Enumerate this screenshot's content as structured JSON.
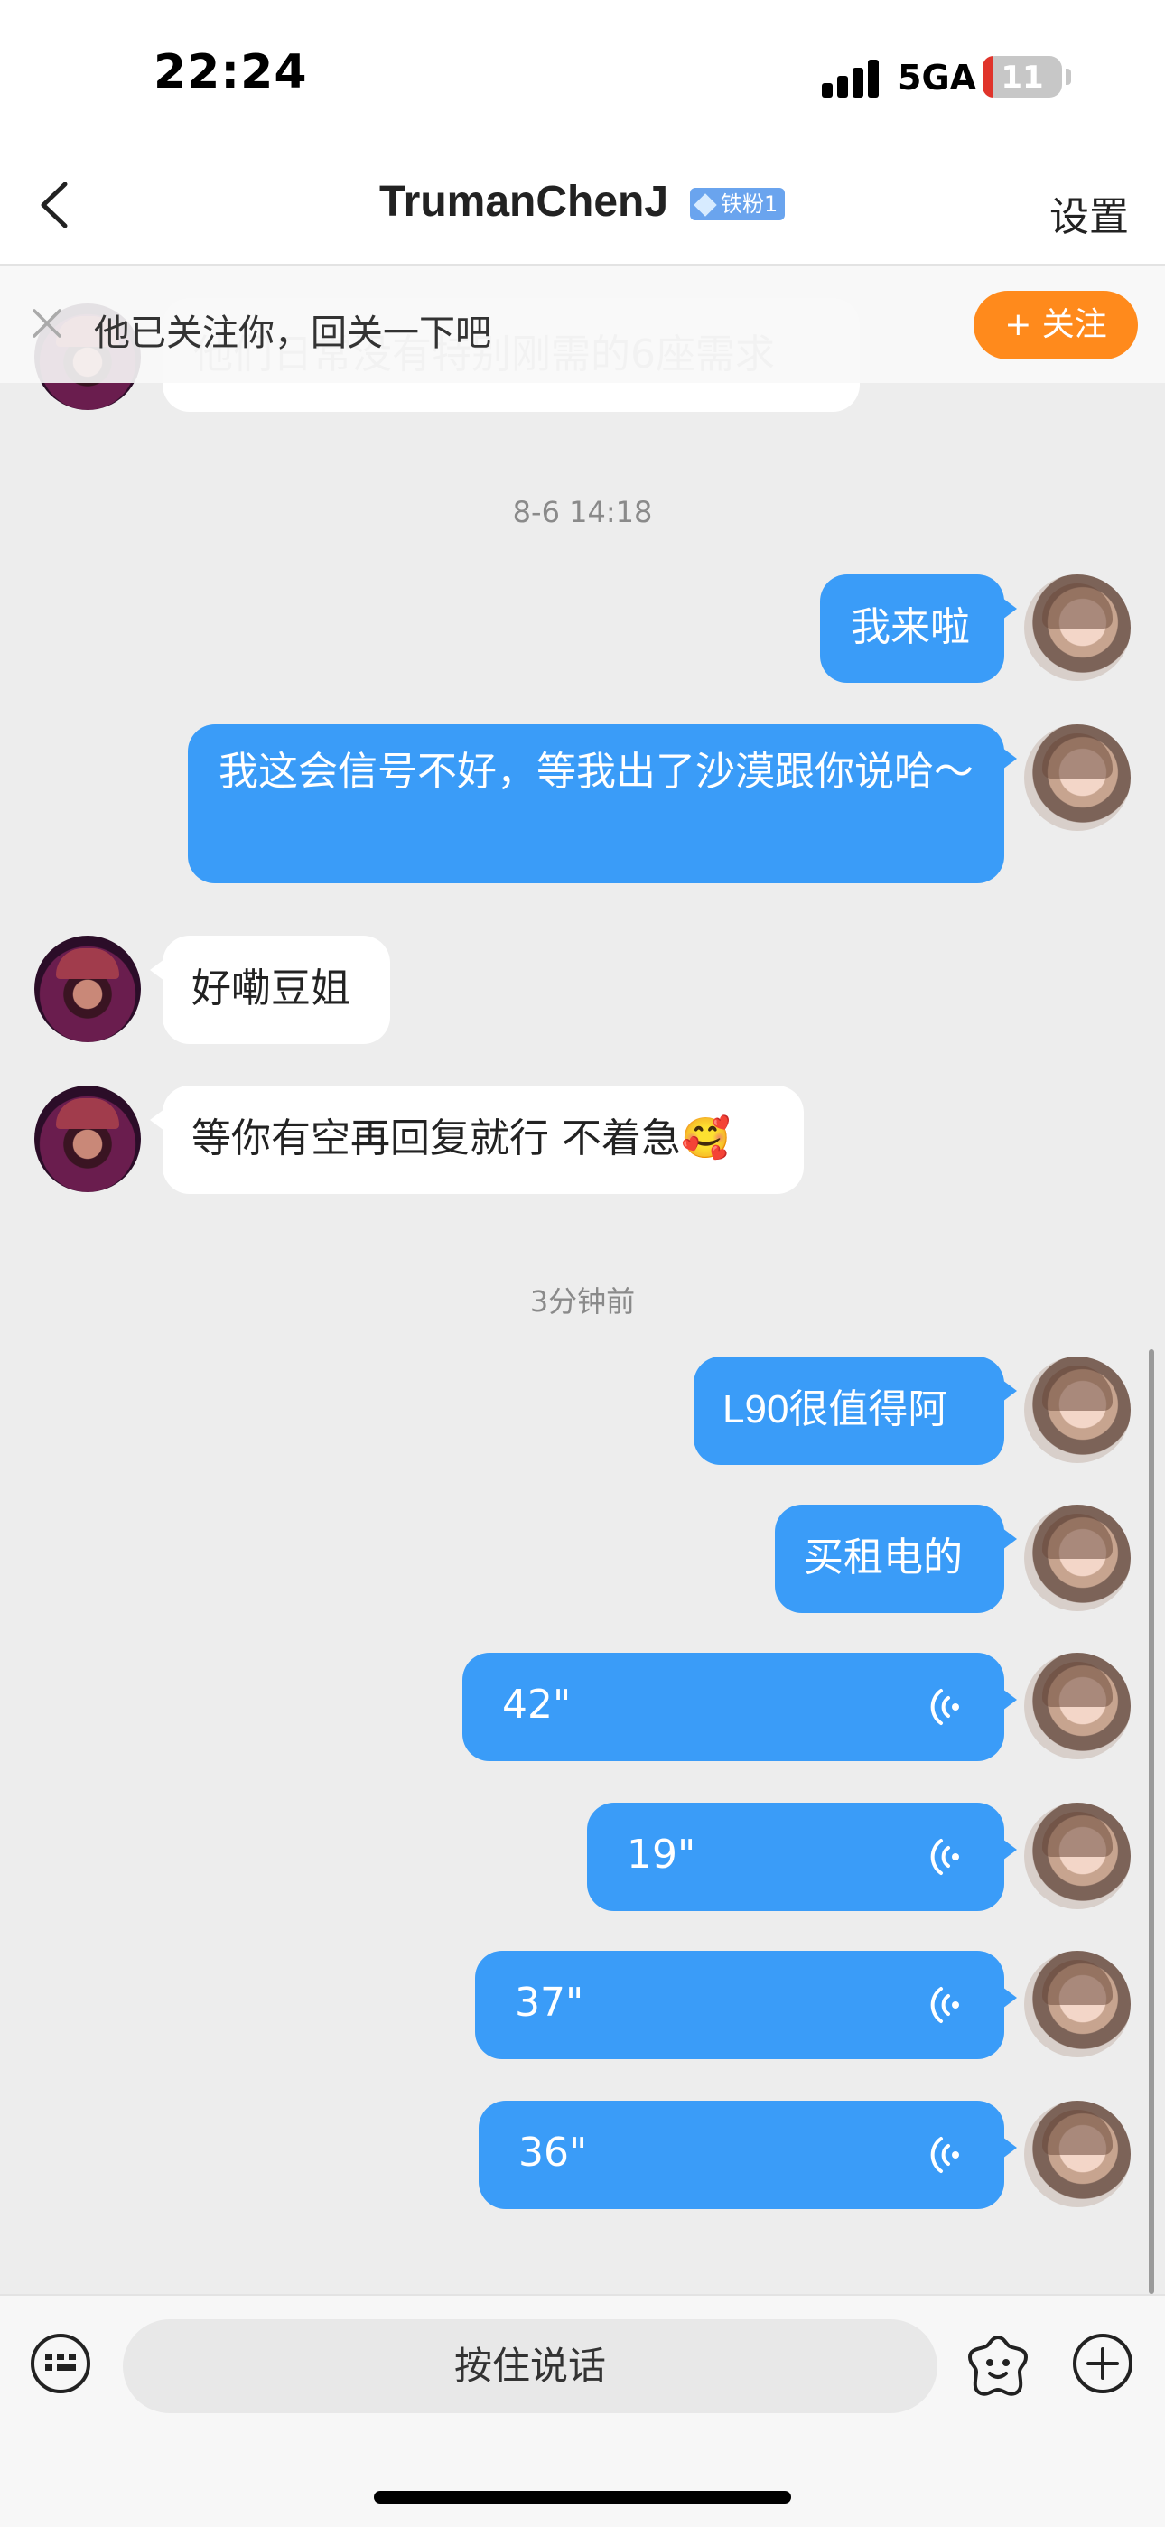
{
  "status_bar": {
    "time": "22:24",
    "network": "5GA",
    "battery": "11"
  },
  "nav": {
    "title": "TrumanChenJ",
    "fan_badge": "铁粉1",
    "settings_label": "设置"
  },
  "follow_banner": {
    "text": "他已关注你，回关一下吧",
    "button_label": "+ 关注",
    "hidden_message_text": "他们日常没有特别刚需的6座需求"
  },
  "timestamps": {
    "first": "8-6 14:18",
    "second": "3分钟前"
  },
  "messages": {
    "m1": "我来啦",
    "m2": "我这会信号不好，等我出了沙漠跟你说哈～",
    "m3": "好嘞豆姐",
    "m4": "等你有空再回复就行 不着急🥰",
    "m5": "L90很值得阿",
    "m6": "买租电的",
    "v1": "42\"",
    "v2": "19\"",
    "v3": "37\"",
    "v4": "36\""
  },
  "bottom_bar": {
    "hold_to_talk": "按住说话"
  },
  "colors": {
    "my_bubble": "#3a9cf8",
    "follow_button": "#ff8a1c",
    "background": "#ededed"
  },
  "icons": [
    "back-arrow-icon",
    "close-icon",
    "keyboard-icon",
    "emoji-icon",
    "plus-icon",
    "voice-wave-icon",
    "gem-icon"
  ]
}
